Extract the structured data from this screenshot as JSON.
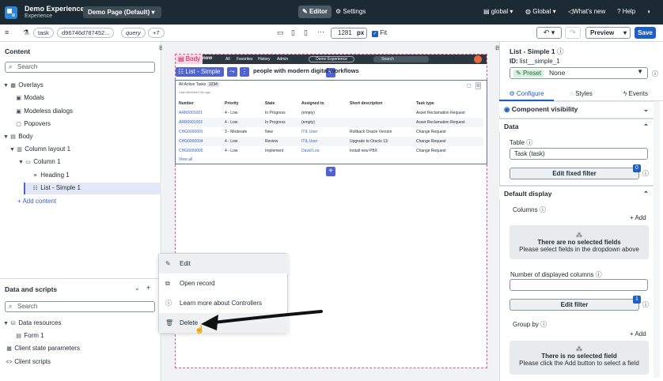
{
  "app": {
    "title": "Demo Experience",
    "subtitle": "Experience",
    "page_selector": "Demo Page (Default)"
  },
  "topbar": {
    "editor": "Editor",
    "settings": "Settings",
    "scope": "global",
    "language": "Global",
    "whats_new": "What's new",
    "help": "Help"
  },
  "subbar": {
    "chip1": "task",
    "chip2": "d96746d787452...",
    "chip3": "query",
    "chip4": "+7",
    "width_value": "1281",
    "width_unit": "px",
    "fit": "Fit",
    "preview": "Preview",
    "save": "Save"
  },
  "left": {
    "content_title": "Content",
    "search_placeholder": "Search",
    "tree": [
      {
        "label": "Overlays"
      },
      {
        "label": "Modals"
      },
      {
        "label": "Modeless dialogs"
      },
      {
        "label": "Popovers"
      },
      {
        "label": "Body"
      },
      {
        "label": "Column layout 1"
      },
      {
        "label": "Column 1"
      },
      {
        "label": "Heading 1"
      },
      {
        "label": "List - Simple 1"
      }
    ],
    "add_content": "Add content",
    "data_title": "Data and scripts",
    "data_search_placeholder": "Search",
    "data_tree": [
      {
        "label": "Data resources"
      },
      {
        "label": "Form 1"
      },
      {
        "label": "Client state parameters"
      },
      {
        "label": "Client scripts"
      }
    ]
  },
  "canvas": {
    "body_tag": "Body",
    "nav": {
      "brand": "now",
      "items": [
        "All",
        "Favorites",
        "History",
        "Admin"
      ],
      "pill": "Demo Experience",
      "search": "Search"
    },
    "selected_label": "List - Simple 1",
    "heading_text": "people with modern digital workflows",
    "list": {
      "title": "All Active Tasks",
      "count": "1234",
      "refreshed": "Last refreshed 4m ago",
      "columns": [
        "Number",
        "Priority",
        "State",
        "Assigned to",
        "Short description",
        "Task type"
      ],
      "rows": [
        [
          "ARR0001001",
          "4 - Low",
          "In Progress",
          "(empty)",
          "",
          "Asset Reclamation Request"
        ],
        [
          "ARR0001002",
          "4 - Low",
          "In Progress",
          "(empty)",
          "",
          "Asset Reclamation Request"
        ],
        [
          "CHG0000001",
          "3 - Moderate",
          "New",
          "ITIL User",
          "Rollback Oracle Version",
          "Change Request"
        ],
        [
          "CHG0000004",
          "4 - Low",
          "Review",
          "ITIL User",
          "Upgrade to Oracle 11i",
          "Change Request"
        ],
        [
          "CHG0000005",
          "4 - Low",
          "Implement",
          "David Loo",
          "Install new PBX",
          "Change Request"
        ]
      ],
      "view_all": "View all"
    }
  },
  "context_menu": {
    "items": [
      {
        "label": "Edit",
        "icon": "pencil-icon"
      },
      {
        "label": "Open record",
        "icon": "external-link-icon"
      },
      {
        "label": "Learn more about Controllers",
        "icon": "info-icon"
      },
      {
        "label": "Delete",
        "icon": "trash-icon"
      }
    ]
  },
  "right": {
    "title": "List - Simple 1",
    "id_label": "ID:",
    "id_value": "list__simple_1",
    "preset_label": "Preset",
    "preset_value": "None",
    "tabs": [
      "Configure",
      "Styles",
      "Events"
    ],
    "component_visibility": "Component visibility",
    "data_section": "Data",
    "table_label": "Table",
    "table_value": "Task (task)",
    "edit_fixed_filter": "Edit fixed filter",
    "fixed_filter_count": "0",
    "default_display": "Default display",
    "columns_label": "Columns",
    "add": "Add",
    "no_fields_title": "There are no selected fields",
    "no_fields_sub": "Please select fields in the dropdown above",
    "num_columns_label": "Number of displayed columns",
    "edit_filter": "Edit filter",
    "filter_count": "1",
    "group_by": "Group by",
    "add2": "Add",
    "no_field_title": "There is no selected field",
    "no_field_sub": "Please click the Add button to select a field"
  }
}
